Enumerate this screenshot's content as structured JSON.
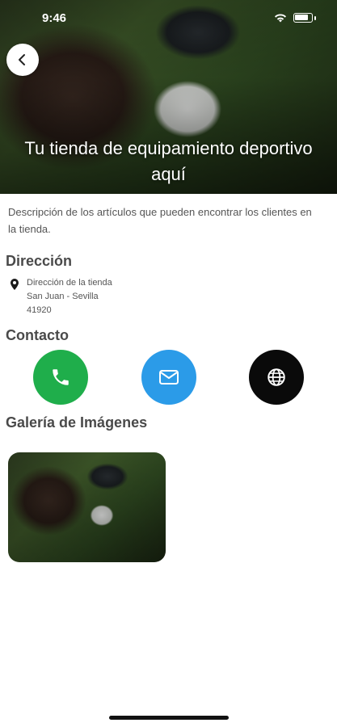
{
  "status_bar": {
    "time": "9:46"
  },
  "hero": {
    "title": "Tu tienda de equipamiento deportivo aquí"
  },
  "description": "Descripción de los artículos que pueden encontrar los clientes en la tienda.",
  "address_section": {
    "title": "Dirección",
    "lines": [
      "Dirección de la tienda",
      "San Juan - Sevilla",
      "41920"
    ]
  },
  "contact_section": {
    "title": "Contacto",
    "buttons": [
      {
        "icon": "phone-icon",
        "color": "#1fae4b"
      },
      {
        "icon": "mail-icon",
        "color": "#2b9be8"
      },
      {
        "icon": "globe-icon",
        "color": "#0a0a0a"
      }
    ]
  },
  "gallery_section": {
    "title": "Galería de Imágenes",
    "images": [
      {
        "subject": "golf-ball-on-grass"
      }
    ]
  }
}
